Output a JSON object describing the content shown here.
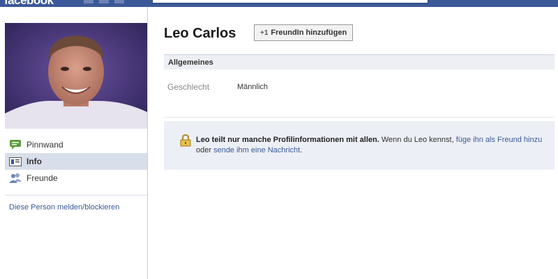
{
  "topbar": {
    "logo_text": "facebook"
  },
  "profile": {
    "name": "Leo Carlos",
    "add_friend_label": "FreundIn hinzufügen",
    "add_friend_symbol": "+1"
  },
  "nav": {
    "items": [
      {
        "label": "Pinnwand",
        "icon": "wall-icon"
      },
      {
        "label": "Info",
        "icon": "info-icon",
        "active": true
      },
      {
        "label": "Freunde",
        "icon": "friends-icon"
      }
    ],
    "report_link": "Diese Person melden/blockieren"
  },
  "info": {
    "section_title": "Allgemeines",
    "gender_label": "Geschlecht",
    "gender_value": "Männlich"
  },
  "notice": {
    "bold_text": "Leo teilt nur manche Profilinformationen mit allen.",
    "plain_1": " Wenn du Leo kennst, ",
    "link_1": "füge ihn als Freund hinzu",
    "plain_2": " oder ",
    "link_2": "sende ihm eine Nachricht",
    "plain_3": "."
  },
  "colors": {
    "brand": "#3b5998",
    "nav_active": "#d8dfea",
    "notice_bg": "#eceff5"
  }
}
